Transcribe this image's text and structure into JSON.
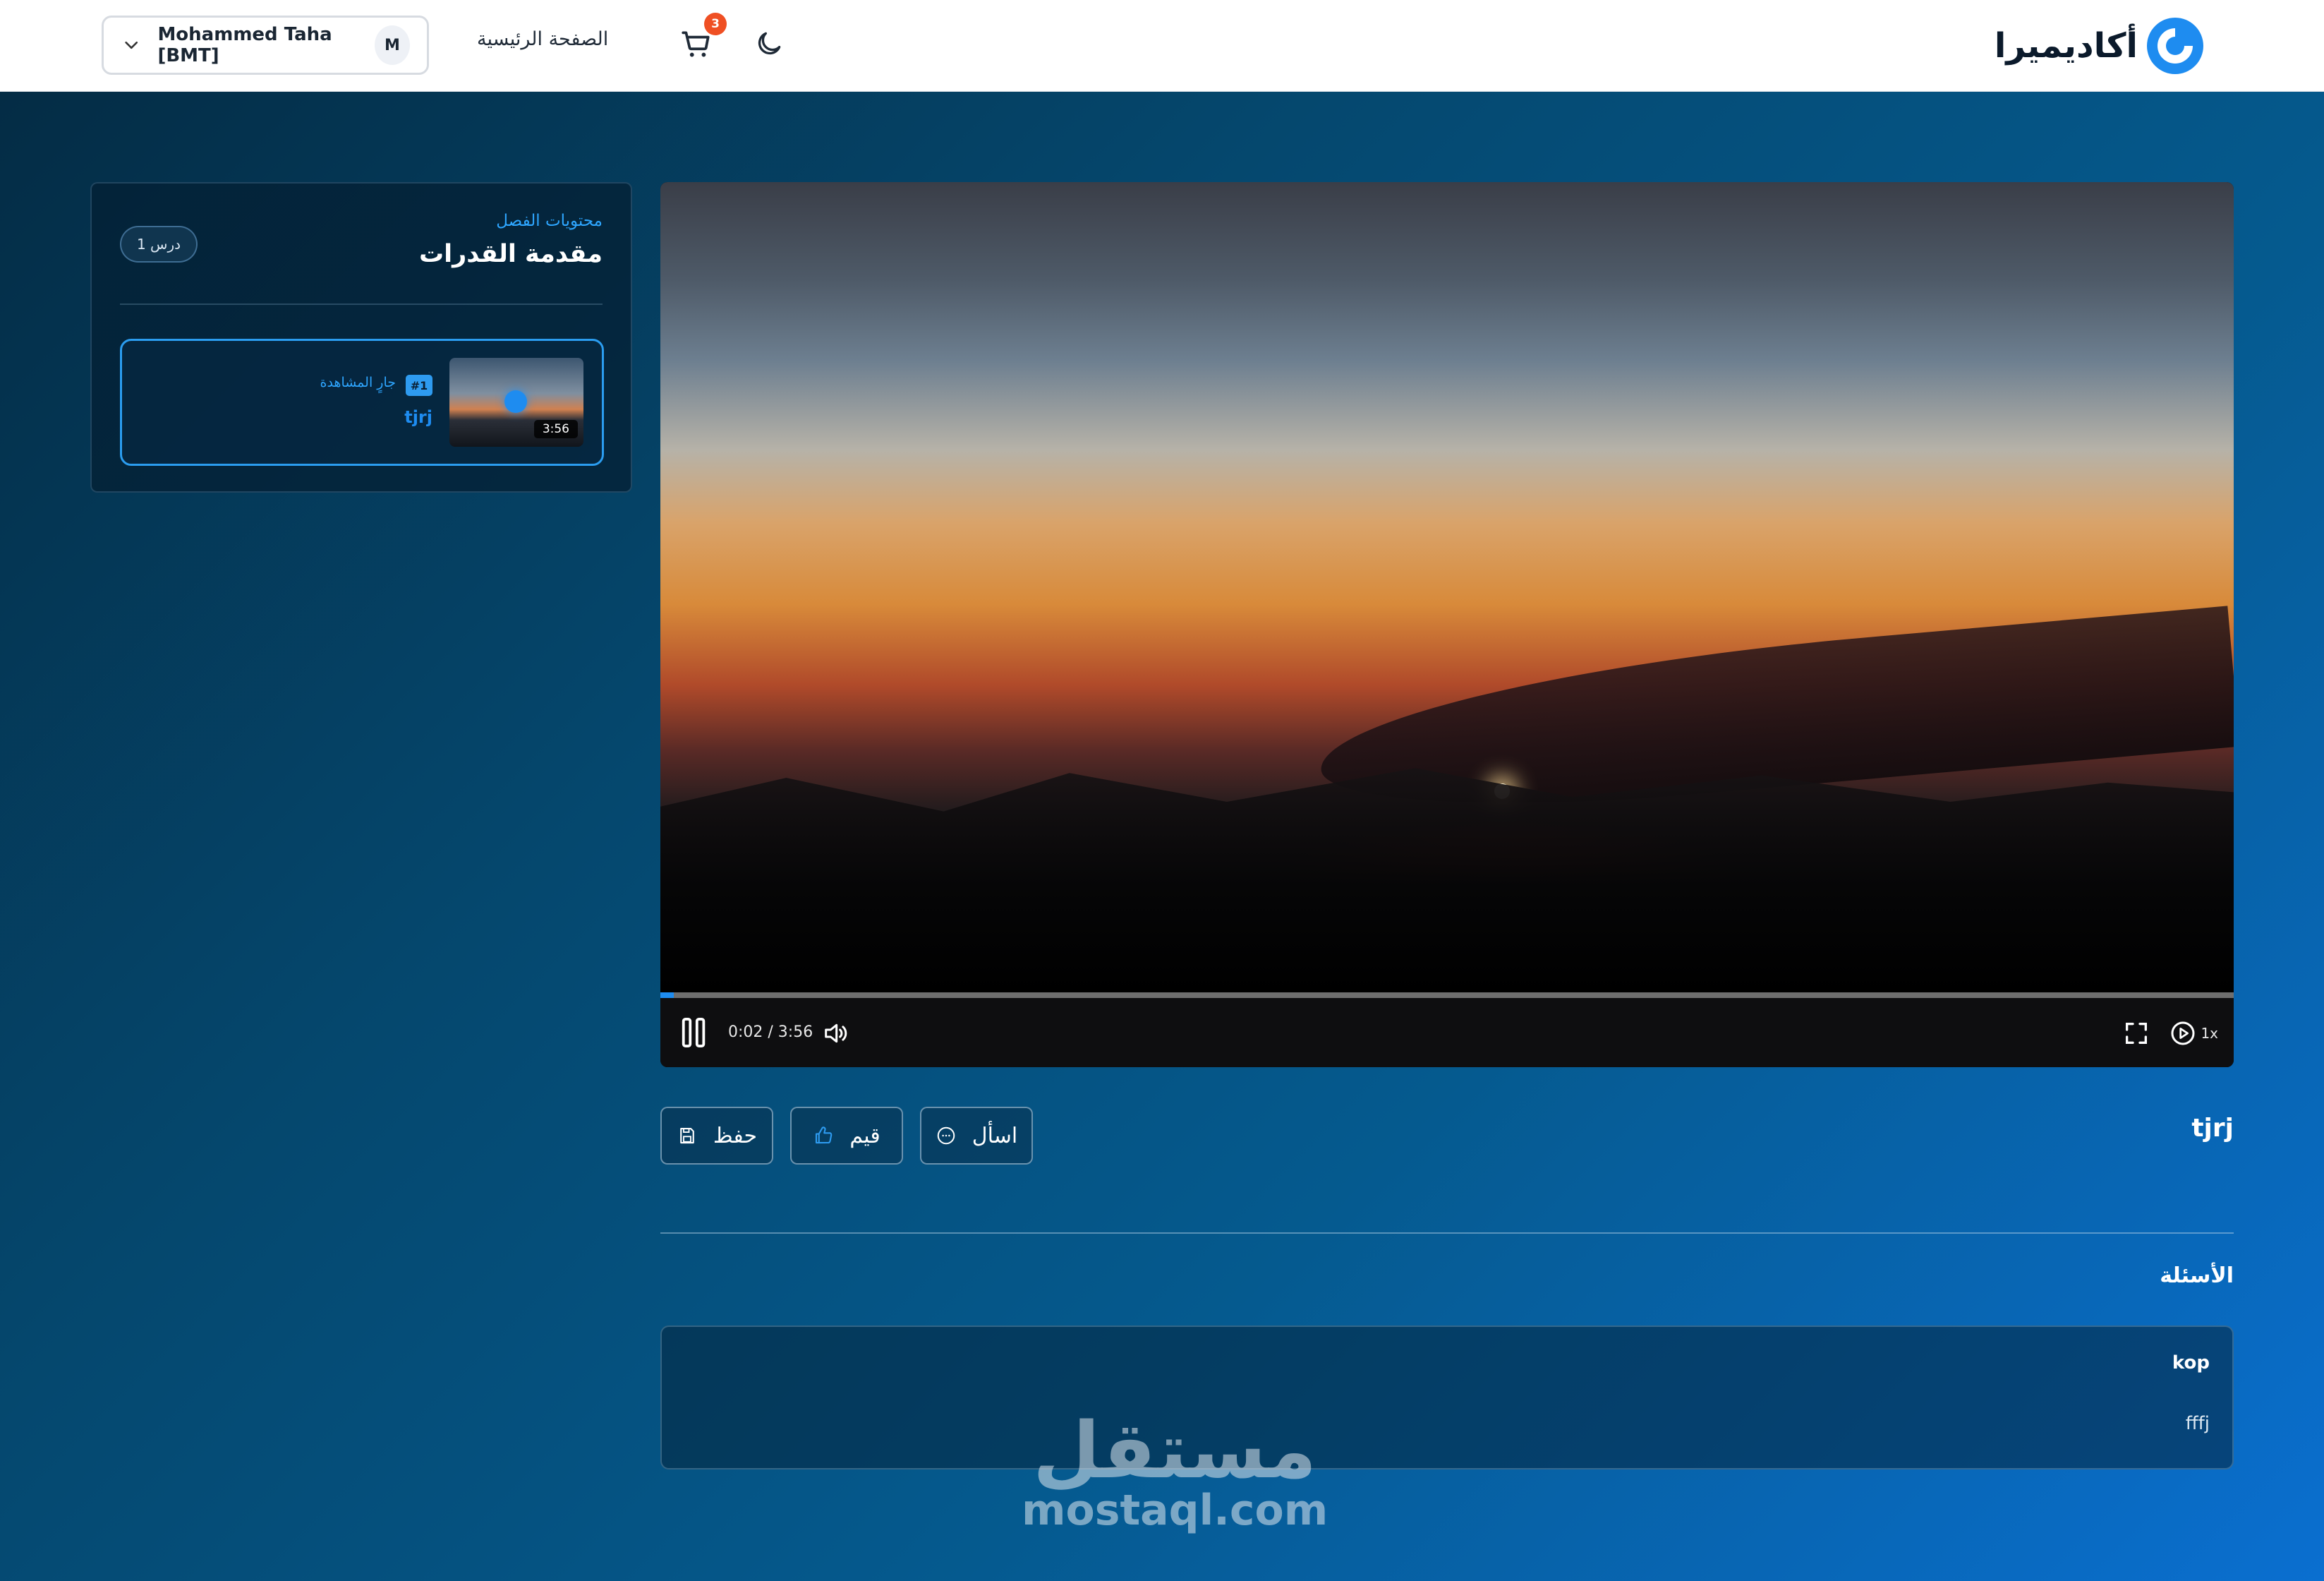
{
  "header": {
    "brand_name": "أكاديميرا",
    "brand_color": "#1e8cf0",
    "home_label": "الصفحة الرئيسية",
    "cart_count": "3",
    "user": {
      "name": "Mohammed Taha [BMT]",
      "initial": "M"
    },
    "icons": [
      "chevron-down-icon",
      "cart-icon",
      "moon-icon"
    ]
  },
  "sidebar": {
    "subtitle": "محتويات الفصل",
    "title": "مقدمة القدرات",
    "lesson_count": "1 درس",
    "lessons": [
      {
        "number": "#1",
        "status": "جارٍ المشاهدة",
        "name": "tjrj",
        "duration": "3:56"
      }
    ]
  },
  "player": {
    "time": "0:02 / 3:56",
    "speed": "1x",
    "progress": 0.0085,
    "icons": [
      "pause-icon",
      "volume-icon",
      "fullscreen-icon",
      "playback-speed-icon"
    ]
  },
  "lesson": {
    "title": "tjrj",
    "actions": {
      "save_label": "حفظ",
      "rate_label": "قيم",
      "ask_label": "اسأل"
    }
  },
  "questions": {
    "title": "الأسئلة",
    "items": [
      {
        "title": "kop",
        "body": "fffj"
      }
    ]
  },
  "watermark": {
    "arabic": "مستقل",
    "latin": "mostaql.com"
  }
}
